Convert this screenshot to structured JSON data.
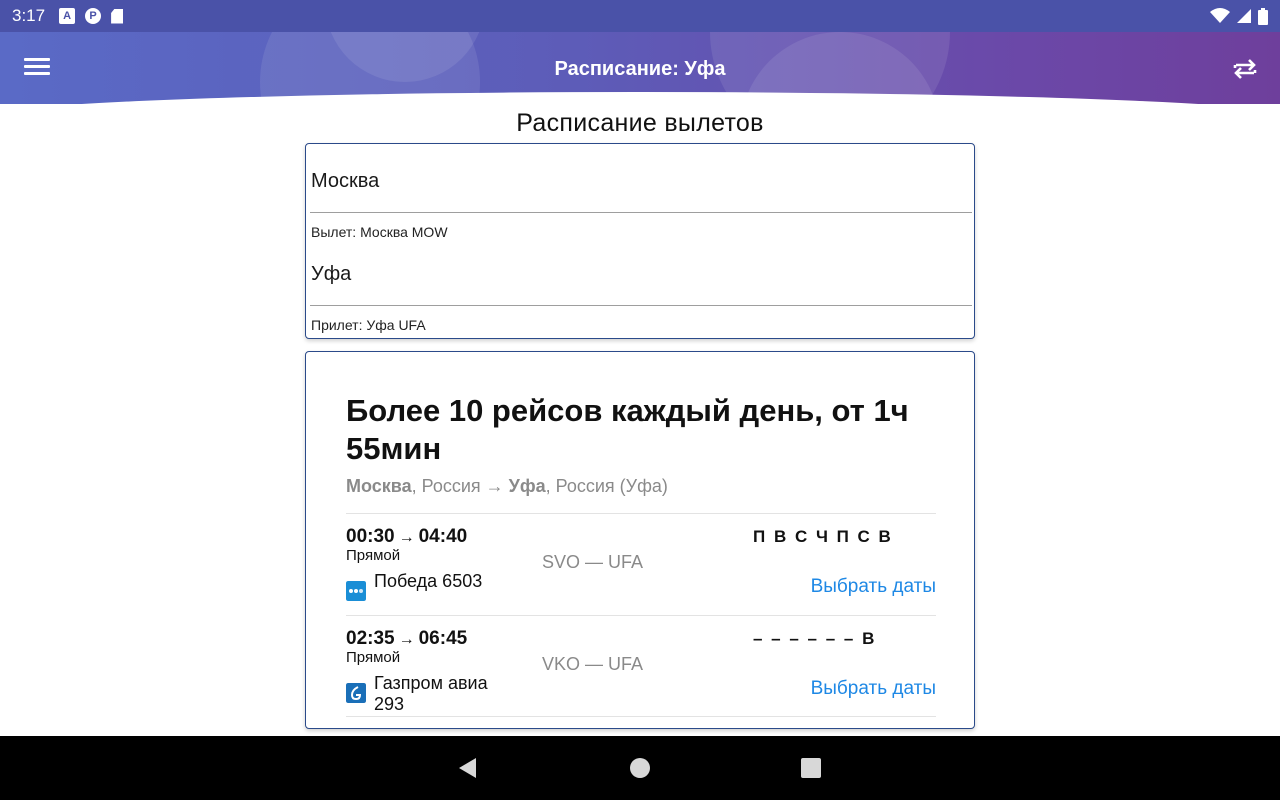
{
  "status_bar": {
    "time": "3:17",
    "left_icons": [
      "a-icon",
      "p-icon",
      "sd-card-icon"
    ],
    "right_icons": [
      "wifi-icon",
      "cellular-signal-icon",
      "battery-icon"
    ],
    "bg": "#4a52a8"
  },
  "app_bar": {
    "title": "Расписание: Уфа",
    "menu_icon": "hamburger-menu-icon",
    "swap_icon": "swap-direction-icon"
  },
  "page": {
    "section_title": "Расписание вылетов"
  },
  "route": {
    "from_value": "Москва",
    "from_hint": "Вылет: Москва MOW",
    "to_value": "Уфа",
    "to_hint": "Прилет: Уфа UFA"
  },
  "flights": {
    "heading": "Более 10 рейсов каждый день, от 1ч 55мин",
    "route_from": "Москва",
    "route_from_country": ", Россия",
    "route_arrow": " → ",
    "route_to": "Уфа",
    "route_to_country": ", Россия (Уфа)",
    "items": [
      {
        "depart": "00:30",
        "arrow": "→",
        "arrive": "04:40",
        "type": "Прямой",
        "airline": "Победа 6503",
        "airline_icon": "pobeda-logo-icon",
        "airline_color": "#1a8ed6",
        "airports": "SVO — UFA",
        "days": "П В С Ч П С В",
        "action": "Выбрать даты"
      },
      {
        "depart": "02:35",
        "arrow": "→",
        "arrive": "06:45",
        "type": "Прямой",
        "airline": "Газпром авиа 293",
        "airline_icon": "gazprom-avia-logo-icon",
        "airline_color": "#1a6fb8",
        "airports": "VKO — UFA",
        "days": "– – – – – – В",
        "action": "Выбрать даты"
      }
    ]
  },
  "nav_bar": {
    "icons": [
      "back-triangle-icon",
      "home-circle-icon",
      "recents-square-icon"
    ]
  },
  "colors": {
    "accent_link": "#1e88e5",
    "card_border": "#2b4a8a",
    "app_bar_gradient_start": "#5a6ac6",
    "app_bar_gradient_end": "#6e3f9c"
  }
}
